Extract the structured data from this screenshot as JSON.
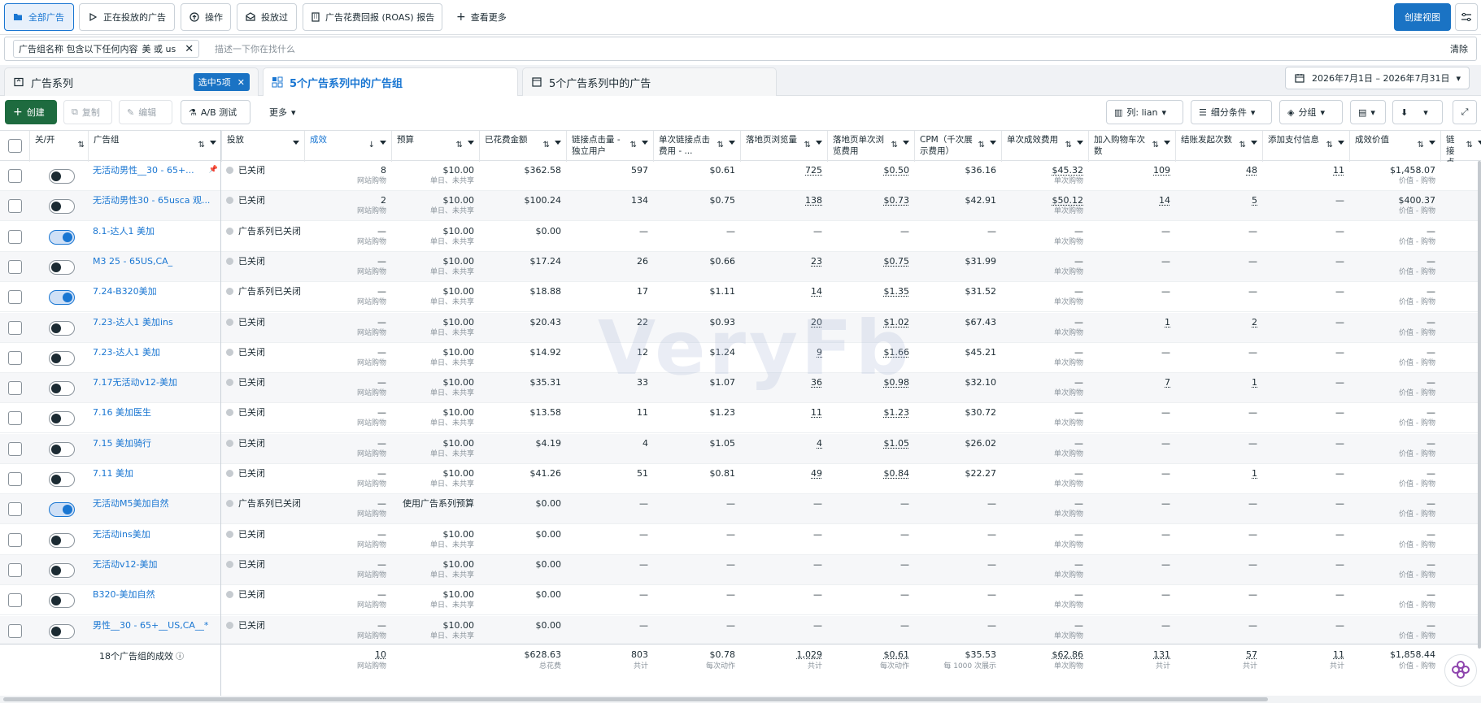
{
  "topbar": {
    "all_ads": "全部广告",
    "active_ads": "正在投放的广告",
    "actions": "操作",
    "delivered": "投放过",
    "roas_report": "广告花费回报 (ROAS) 报告",
    "more_views": "查看更多",
    "create_view": "创建视图"
  },
  "filter": {
    "chip_label": "广告组名称 包含以下任何内容",
    "chip_value": "美 或 us",
    "placeholder": "描述一下你在找什么",
    "clear": "清除"
  },
  "tabs": {
    "campaigns": "广告系列",
    "selected_badge": "选中5项",
    "adsets": "5个广告系列中的广告组",
    "ads": "5个广告系列中的广告"
  },
  "date_range": "2026年7月1日 – 2026年7月31日",
  "toolbar": {
    "create": "创建",
    "duplicate": "复制",
    "edit": "编辑",
    "ab_test": "A/B 测试",
    "more": "更多",
    "columns": "列: lian",
    "breakdown": "细分条件",
    "group": "分组"
  },
  "columns": [
    "关/开",
    "广告组",
    "投放",
    "成效",
    "预算",
    "已花费金额",
    "链接点击量 - 独立用户",
    "单次链接点击费用 - ...",
    "落地页浏览量",
    "落地页单次浏览费用",
    "CPM（千次展示费用）",
    "单次成效费用",
    "加入购物车次数",
    "结账发起次数",
    "添加支付信息",
    "成效价值",
    "链接点击 - 独立用户"
  ],
  "rows": [
    {
      "on": false,
      "name": "无活动男性__30 - 65+...",
      "pin": true,
      "status": "已关闭",
      "result": "8",
      "result_sub": "网站购物",
      "budget": "$10.00",
      "budget_sub": "单日、未共享",
      "spend": "$362.58",
      "clicks": "597",
      "cpc": "$0.61",
      "lpv": "725",
      "cplpv": "$0.50",
      "cpm": "$36.16",
      "cpr": "$45.32",
      "cpr_sub": "单次购物",
      "atc": "109",
      "checkout": "48",
      "payinfo": "11",
      "value": "$1,458.07",
      "value_sub": "价值 - 购物"
    },
    {
      "on": false,
      "name": "无活动男性30 - 65usca 观...",
      "pin": false,
      "status": "已关闭",
      "result": "2",
      "result_sub": "网站购物",
      "budget": "$10.00",
      "budget_sub": "单日、未共享",
      "spend": "$100.24",
      "clicks": "134",
      "cpc": "$0.75",
      "lpv": "138",
      "cplpv": "$0.73",
      "cpm": "$42.91",
      "cpr": "$50.12",
      "cpr_sub": "单次购物",
      "atc": "14",
      "checkout": "5",
      "payinfo": "—",
      "value": "$400.37",
      "value_sub": "价值 - 购物"
    },
    {
      "on": true,
      "name": "8.1-达人1 美加",
      "pin": false,
      "status": "广告系列已关闭",
      "result": "—",
      "result_sub": "网站购物",
      "budget": "$10.00",
      "budget_sub": "单日、未共享",
      "spend": "$0.00",
      "clicks": "—",
      "cpc": "—",
      "lpv": "—",
      "cplpv": "—",
      "cpm": "—",
      "cpr": "—",
      "cpr_sub": "单次购物",
      "atc": "—",
      "checkout": "—",
      "payinfo": "—",
      "value": "—",
      "value_sub": "价值 - 购物"
    },
    {
      "on": false,
      "name": "M3 25 - 65US,CA_",
      "pin": false,
      "status": "已关闭",
      "result": "—",
      "result_sub": "网站购物",
      "budget": "$10.00",
      "budget_sub": "单日、未共享",
      "spend": "$17.24",
      "clicks": "26",
      "cpc": "$0.66",
      "lpv": "23",
      "cplpv": "$0.75",
      "cpm": "$31.99",
      "cpr": "—",
      "cpr_sub": "单次购物",
      "atc": "—",
      "checkout": "—",
      "payinfo": "—",
      "value": "—",
      "value_sub": "价值 - 购物"
    },
    {
      "on": true,
      "name": "7.24-B320美加",
      "pin": false,
      "status": "广告系列已关闭",
      "result": "—",
      "result_sub": "网站购物",
      "budget": "$10.00",
      "budget_sub": "单日、未共享",
      "spend": "$18.88",
      "clicks": "17",
      "cpc": "$1.11",
      "lpv": "14",
      "cplpv": "$1.35",
      "cpm": "$31.52",
      "cpr": "—",
      "cpr_sub": "单次购物",
      "atc": "—",
      "checkout": "—",
      "payinfo": "—",
      "value": "—",
      "value_sub": "价值 - 购物"
    },
    {
      "on": false,
      "name": "7.23-达人1 美加ins",
      "pin": false,
      "status": "已关闭",
      "result": "—",
      "result_sub": "网站购物",
      "budget": "$10.00",
      "budget_sub": "单日、未共享",
      "spend": "$20.43",
      "clicks": "22",
      "cpc": "$0.93",
      "lpv": "20",
      "cplpv": "$1.02",
      "cpm": "$67.43",
      "cpr": "—",
      "cpr_sub": "单次购物",
      "atc": "1",
      "checkout": "2",
      "payinfo": "—",
      "value": "—",
      "value_sub": "价值 - 购物"
    },
    {
      "on": false,
      "name": "7.23-达人1 美加",
      "pin": false,
      "status": "已关闭",
      "result": "—",
      "result_sub": "网站购物",
      "budget": "$10.00",
      "budget_sub": "单日、未共享",
      "spend": "$14.92",
      "clicks": "12",
      "cpc": "$1.24",
      "lpv": "9",
      "cplpv": "$1.66",
      "cpm": "$45.21",
      "cpr": "—",
      "cpr_sub": "单次购物",
      "atc": "—",
      "checkout": "—",
      "payinfo": "—",
      "value": "—",
      "value_sub": "价值 - 购物"
    },
    {
      "on": false,
      "name": "7.17无活动v12-美加",
      "pin": false,
      "status": "已关闭",
      "result": "—",
      "result_sub": "网站购物",
      "budget": "$10.00",
      "budget_sub": "单日、未共享",
      "spend": "$35.31",
      "clicks": "33",
      "cpc": "$1.07",
      "lpv": "36",
      "cplpv": "$0.98",
      "cpm": "$32.10",
      "cpr": "—",
      "cpr_sub": "单次购物",
      "atc": "7",
      "checkout": "1",
      "payinfo": "—",
      "value": "—",
      "value_sub": "价值 - 购物"
    },
    {
      "on": false,
      "name": "7.16 美加医生",
      "pin": false,
      "status": "已关闭",
      "result": "—",
      "result_sub": "网站购物",
      "budget": "$10.00",
      "budget_sub": "单日、未共享",
      "spend": "$13.58",
      "clicks": "11",
      "cpc": "$1.23",
      "lpv": "11",
      "cplpv": "$1.23",
      "cpm": "$30.72",
      "cpr": "—",
      "cpr_sub": "单次购物",
      "atc": "—",
      "checkout": "—",
      "payinfo": "—",
      "value": "—",
      "value_sub": "价值 - 购物"
    },
    {
      "on": false,
      "name": "7.15 美加骑行",
      "pin": false,
      "status": "已关闭",
      "result": "—",
      "result_sub": "网站购物",
      "budget": "$10.00",
      "budget_sub": "单日、未共享",
      "spend": "$4.19",
      "clicks": "4",
      "cpc": "$1.05",
      "lpv": "4",
      "cplpv": "$1.05",
      "cpm": "$26.02",
      "cpr": "—",
      "cpr_sub": "单次购物",
      "atc": "—",
      "checkout": "—",
      "payinfo": "—",
      "value": "—",
      "value_sub": "价值 - 购物"
    },
    {
      "on": false,
      "name": "7.11 美加",
      "pin": false,
      "status": "已关闭",
      "result": "—",
      "result_sub": "网站购物",
      "budget": "$10.00",
      "budget_sub": "单日、未共享",
      "spend": "$41.26",
      "clicks": "51",
      "cpc": "$0.81",
      "lpv": "49",
      "cplpv": "$0.84",
      "cpm": "$22.27",
      "cpr": "—",
      "cpr_sub": "单次购物",
      "atc": "—",
      "checkout": "1",
      "payinfo": "—",
      "value": "—",
      "value_sub": "价值 - 购物"
    },
    {
      "on": true,
      "name": "无活动M5美加自然",
      "pin": false,
      "status": "广告系列已关闭",
      "result": "—",
      "result_sub": "网站购物",
      "budget": "使用广告系列预算",
      "budget_sub": "",
      "spend": "$0.00",
      "clicks": "—",
      "cpc": "—",
      "lpv": "—",
      "cplpv": "—",
      "cpm": "—",
      "cpr": "—",
      "cpr_sub": "单次购物",
      "atc": "—",
      "checkout": "—",
      "payinfo": "—",
      "value": "—",
      "value_sub": "价值 - 购物"
    },
    {
      "on": false,
      "name": "无活动ins美加",
      "pin": false,
      "status": "已关闭",
      "result": "—",
      "result_sub": "网站购物",
      "budget": "$10.00",
      "budget_sub": "单日、未共享",
      "spend": "$0.00",
      "clicks": "—",
      "cpc": "—",
      "lpv": "—",
      "cplpv": "—",
      "cpm": "—",
      "cpr": "—",
      "cpr_sub": "单次购物",
      "atc": "—",
      "checkout": "—",
      "payinfo": "—",
      "value": "—",
      "value_sub": "价值 - 购物"
    },
    {
      "on": false,
      "name": "无活动v12-美加",
      "pin": false,
      "status": "已关闭",
      "result": "—",
      "result_sub": "网站购物",
      "budget": "$10.00",
      "budget_sub": "单日、未共享",
      "spend": "$0.00",
      "clicks": "—",
      "cpc": "—",
      "lpv": "—",
      "cplpv": "—",
      "cpm": "—",
      "cpr": "—",
      "cpr_sub": "单次购物",
      "atc": "—",
      "checkout": "—",
      "payinfo": "—",
      "value": "—",
      "value_sub": "价值 - 购物"
    },
    {
      "on": false,
      "name": "B320-美加自然",
      "pin": false,
      "status": "已关闭",
      "result": "—",
      "result_sub": "网站购物",
      "budget": "$10.00",
      "budget_sub": "单日、未共享",
      "spend": "$0.00",
      "clicks": "—",
      "cpc": "—",
      "lpv": "—",
      "cplpv": "—",
      "cpm": "—",
      "cpr": "—",
      "cpr_sub": "单次购物",
      "atc": "—",
      "checkout": "—",
      "payinfo": "—",
      "value": "—",
      "value_sub": "价值 - 购物"
    },
    {
      "on": false,
      "name": "男性__30 - 65+__US,CA__*",
      "pin": false,
      "status": "已关闭",
      "result": "—",
      "result_sub": "网站购物",
      "budget": "$10.00",
      "budget_sub": "单日、未共享",
      "spend": "$0.00",
      "clicks": "—",
      "cpc": "—",
      "lpv": "—",
      "cplpv": "—",
      "cpm": "—",
      "cpr": "—",
      "cpr_sub": "单次购物",
      "atc": "—",
      "checkout": "—",
      "payinfo": "—",
      "value": "—",
      "value_sub": "价值 - 购物"
    }
  ],
  "totals": {
    "label": "18个广告组的成效",
    "result": "10",
    "result_sub": "网站购物",
    "spend": "$628.63",
    "spend_sub": "总花费",
    "clicks": "803",
    "clicks_sub": "共计",
    "cpc": "$0.78",
    "cpc_sub": "每次动作",
    "lpv": "1,029",
    "lpv_sub": "共计",
    "cplpv": "$0.61",
    "cplpv_sub": "每次动作",
    "cpm": "$35.53",
    "cpm_sub": "每 1000 次展示",
    "cpr": "$62.86",
    "cpr_sub": "单次购物",
    "atc": "131",
    "atc_sub": "共计",
    "checkout": "57",
    "checkout_sub": "共计",
    "payinfo": "11",
    "payinfo_sub": "共计",
    "value": "$1,858.44",
    "value_sub": "价值 - 购物"
  },
  "watermark": "VeryFb",
  "colors": {
    "accent": "#1976d2",
    "primary_button": "#1a73c4",
    "create_button": "#1e6b3f"
  }
}
